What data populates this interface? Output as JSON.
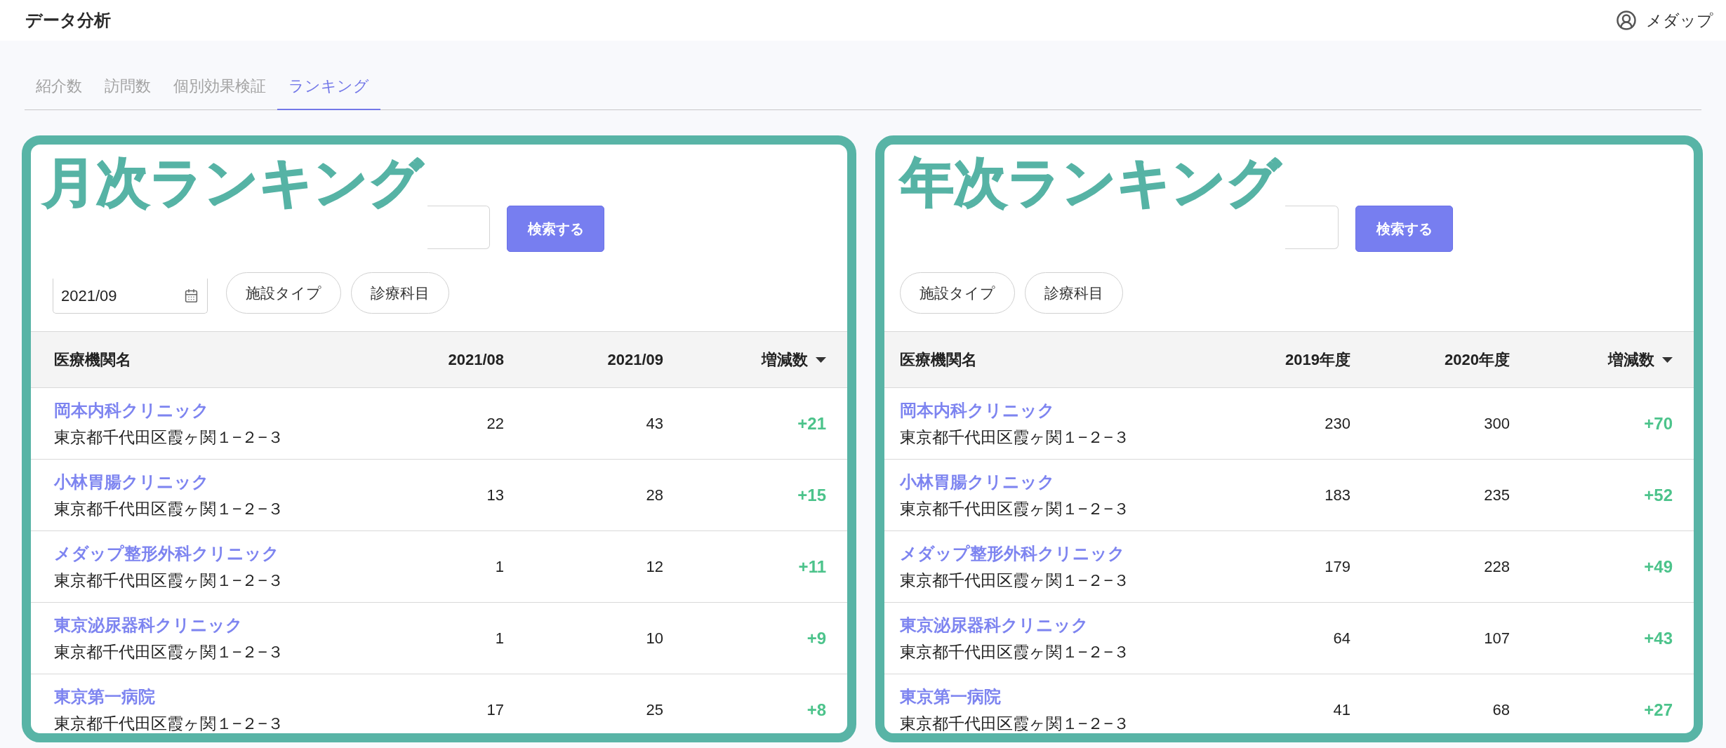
{
  "header": {
    "title": "データ分析",
    "user_name": "メダップ"
  },
  "tabs": [
    {
      "label": "紹介数",
      "selected": false
    },
    {
      "label": "訪問数",
      "selected": false
    },
    {
      "label": "個別効果検証",
      "selected": false
    },
    {
      "label": "ランキング",
      "selected": true
    }
  ],
  "panels": [
    {
      "title": "月次ランキング",
      "search_button": "検索する",
      "month_field": {
        "value": "2021/09"
      },
      "filters": [
        "施設タイプ",
        "診療科目"
      ],
      "table": {
        "columns": [
          {
            "label": "医療機関名",
            "sorted": false
          },
          {
            "label": "2021/08",
            "sorted": false
          },
          {
            "label": "2021/09",
            "sorted": false
          },
          {
            "label": "増減数",
            "sorted": true
          }
        ],
        "rows": [
          {
            "name": "岡本内科クリニック",
            "address": "東京都千代田区霞ヶ関１−２−３",
            "values": [
              "22",
              "43"
            ],
            "change": "+21"
          },
          {
            "name": "小林胃腸クリニック",
            "address": "東京都千代田区霞ヶ関１−２−３",
            "values": [
              "13",
              "28"
            ],
            "change": "+15"
          },
          {
            "name": "メダップ整形外科クリニック",
            "address": "東京都千代田区霞ヶ関１−２−３",
            "values": [
              "1",
              "12"
            ],
            "change": "+11"
          },
          {
            "name": "東京泌尿器科クリニック",
            "address": "東京都千代田区霞ヶ関１−２−３",
            "values": [
              "1",
              "10"
            ],
            "change": "+9"
          },
          {
            "name": "東京第一病院",
            "address": "東京都千代田区霞ヶ関１−２−３",
            "values": [
              "17",
              "25"
            ],
            "change": "+8"
          }
        ]
      }
    },
    {
      "title": "年次ランキング",
      "search_button": "検索する",
      "filters": [
        "施設タイプ",
        "診療科目"
      ],
      "table": {
        "columns": [
          {
            "label": "医療機関名",
            "sorted": false
          },
          {
            "label": "2019年度",
            "sorted": false
          },
          {
            "label": "2020年度",
            "sorted": false
          },
          {
            "label": "増減数",
            "sorted": true
          }
        ],
        "rows": [
          {
            "name": "岡本内科クリニック",
            "address": "東京都千代田区霞ヶ関１−２−３",
            "values": [
              "230",
              "300"
            ],
            "change": "+70"
          },
          {
            "name": "小林胃腸クリニック",
            "address": "東京都千代田区霞ヶ関１−２−３",
            "values": [
              "183",
              "235"
            ],
            "change": "+52"
          },
          {
            "name": "メダップ整形外科クリニック",
            "address": "東京都千代田区霞ヶ関１−２−３",
            "values": [
              "179",
              "228"
            ],
            "change": "+49"
          },
          {
            "name": "東京泌尿器科クリニック",
            "address": "東京都千代田区霞ヶ関１−２−３",
            "values": [
              "64",
              "107"
            ],
            "change": "+43"
          },
          {
            "name": "東京第一病院",
            "address": "東京都千代田区霞ヶ関１−２−３",
            "values": [
              "41",
              "68"
            ],
            "change": "+27"
          }
        ]
      }
    }
  ]
}
